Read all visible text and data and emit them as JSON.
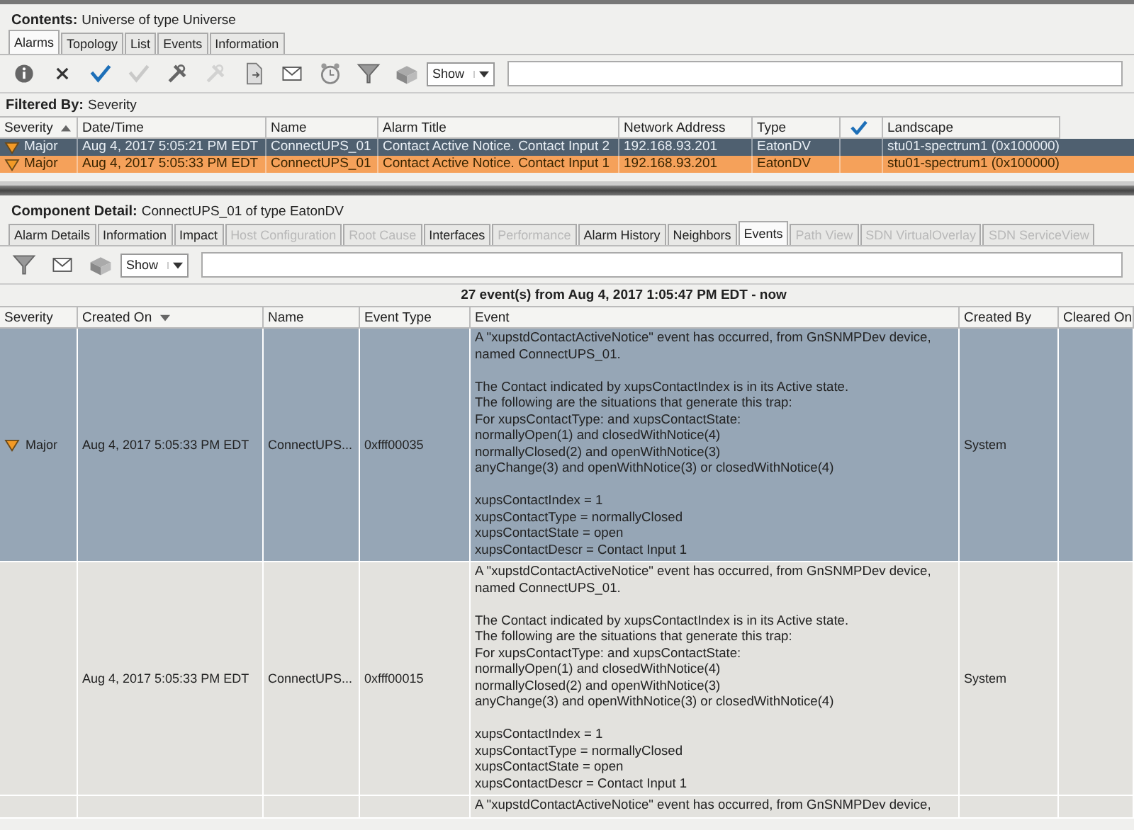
{
  "contents": {
    "label": "Contents:",
    "value": "Universe of type Universe"
  },
  "top_tabs": [
    {
      "label": "Alarms",
      "selected": true,
      "disabled": false
    },
    {
      "label": "Topology",
      "selected": false,
      "disabled": false
    },
    {
      "label": "List",
      "selected": false,
      "disabled": false
    },
    {
      "label": "Events",
      "selected": false,
      "disabled": false
    },
    {
      "label": "Information",
      "selected": false,
      "disabled": false
    }
  ],
  "top_toolbar": {
    "tools": [
      {
        "kind": "info",
        "disabled": false
      },
      {
        "kind": "clear",
        "disabled": false
      },
      {
        "kind": "ack",
        "disabled": false
      },
      {
        "kind": "ack",
        "disabled": true
      },
      {
        "kind": "tools",
        "disabled": false
      },
      {
        "kind": "tools",
        "disabled": true
      },
      {
        "kind": "document",
        "disabled": false
      },
      {
        "kind": "mail",
        "disabled": false
      },
      {
        "kind": "clock",
        "disabled": false
      },
      {
        "kind": "filter",
        "disabled": false
      },
      {
        "kind": "stack",
        "disabled": false
      }
    ],
    "show": "Show"
  },
  "filter": {
    "label": "Filtered By:",
    "value": "Severity"
  },
  "alarm_table": {
    "columns": [
      {
        "kind": "text",
        "label": "Severity",
        "sort_ascending": true
      },
      {
        "kind": "text",
        "label": "Date/Time"
      },
      {
        "kind": "text",
        "label": "Name"
      },
      {
        "kind": "text",
        "label": "Alarm Title"
      },
      {
        "kind": "text",
        "label": "Network Address"
      },
      {
        "kind": "text",
        "label": "Type"
      },
      {
        "kind": "check"
      },
      {
        "kind": "text",
        "label": "Landscape"
      }
    ],
    "rows": [
      {
        "selected": true,
        "cells": [
          "Major",
          "Aug 4, 2017 5:05:21 PM EDT",
          "ConnectUPS_01",
          "Contact Active Notice.  Contact Input 2",
          "192.168.93.201",
          "EatonDV",
          "",
          "stu01-spectrum1 (0x100000)"
        ]
      },
      {
        "selected": false,
        "cells": [
          "Major",
          "Aug 4, 2017 5:05:33 PM EDT",
          "ConnectUPS_01",
          "Contact Active Notice.  Contact Input 1",
          "192.168.93.201",
          "EatonDV",
          "",
          "stu01-spectrum1 (0x100000)"
        ]
      }
    ]
  },
  "detail": {
    "label": "Component Detail:",
    "value": "ConnectUPS_01 of type EatonDV"
  },
  "detail_tabs": [
    {
      "label": "Alarm Details",
      "selected": false,
      "disabled": false
    },
    {
      "label": "Information",
      "selected": false,
      "disabled": false
    },
    {
      "label": "Impact",
      "selected": false,
      "disabled": false
    },
    {
      "label": "Host Configuration",
      "selected": false,
      "disabled": true
    },
    {
      "label": "Root Cause",
      "selected": false,
      "disabled": true
    },
    {
      "label": "Interfaces",
      "selected": false,
      "disabled": false
    },
    {
      "label": "Performance",
      "selected": false,
      "disabled": true
    },
    {
      "label": "Alarm History",
      "selected": false,
      "disabled": false
    },
    {
      "label": "Neighbors",
      "selected": false,
      "disabled": false
    },
    {
      "label": "Events",
      "selected": true,
      "disabled": false
    },
    {
      "label": "Path View",
      "selected": false,
      "disabled": true
    },
    {
      "label": "SDN VirtualOverlay",
      "selected": false,
      "disabled": true
    },
    {
      "label": "SDN ServiceView",
      "selected": false,
      "disabled": true
    }
  ],
  "detail_toolbar": {
    "tools": [
      {
        "kind": "filter",
        "disabled": false
      },
      {
        "kind": "mail",
        "disabled": false
      },
      {
        "kind": "stack",
        "disabled": false
      }
    ],
    "show": "Show"
  },
  "events_summary": "27 event(s) from Aug 4, 2017 1:05:47 PM EDT - now",
  "event_table": {
    "columns": [
      {
        "label": "Severity"
      },
      {
        "label": "Created On",
        "sort_ascending": false
      },
      {
        "label": "Name"
      },
      {
        "label": "Event Type"
      },
      {
        "label": "Event"
      },
      {
        "label": "Created By"
      },
      {
        "label": "Cleared On"
      }
    ],
    "rows": [
      {
        "selected": true,
        "severity": "Major",
        "created_on": "Aug 4, 2017 5:05:33 PM EDT",
        "name": "ConnectUPS...",
        "event_type": "0xfff00035",
        "event": "A \"xupstdContactActiveNotice\" event has occurred, from GnSNMPDev device,\nnamed ConnectUPS_01.\n\nThe Contact indicated by xupsContactIndex is in its Active state.\nThe following are the situations that generate this trap:\nFor xupsContactType: and xupsContactState:\nnormallyOpen(1) and closedWithNotice(4)\nnormallyClosed(2) and openWithNotice(3)\nanyChange(3) and openWithNotice(3) or closedWithNotice(4)\n\nxupsContactIndex = 1\nxupsContactType = normallyClosed\nxupsContactState = open\nxupsContactDescr = Contact Input 1",
        "created_by": "System"
      },
      {
        "selected": false,
        "created_on": "Aug 4, 2017 5:05:33 PM EDT",
        "name": "ConnectUPS...",
        "event_type": "0xfff00015",
        "event": "A \"xupstdContactActiveNotice\" event has occurred, from GnSNMPDev device,\nnamed ConnectUPS_01.\n\nThe Contact indicated by xupsContactIndex is in its Active state.\nThe following are the situations that generate this trap:\nFor xupsContactType: and xupsContactState:\nnormallyOpen(1) and closedWithNotice(4)\nnormallyClosed(2) and openWithNotice(3)\nanyChange(3) and openWithNotice(3) or closedWithNotice(4)\n\nxupsContactIndex = 1\nxupsContactType = normallyClosed\nxupsContactState = open\nxupsContactDescr = Contact Input 1",
        "created_by": "System"
      },
      {
        "selected": false,
        "event": "A \"xupstdContactActiveNotice\" event has occurred, from GnSNMPDev device,"
      }
    ]
  }
}
